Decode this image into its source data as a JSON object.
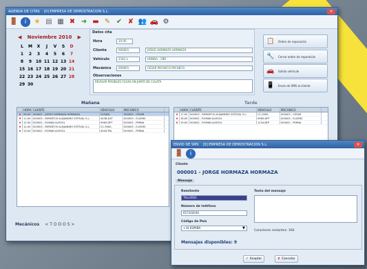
{
  "main_window": {
    "title": "AGENDA DE CITAS",
    "company": "[0] EMPRESA DE DEMOSTRACION S.L.",
    "close_label": "×"
  },
  "calendar": {
    "month_title": "Noviembre 2010",
    "weekdays": [
      "L",
      "M",
      "X",
      "J",
      "V",
      "S",
      "D"
    ],
    "days": [
      [
        "1",
        "2",
        "3",
        "4",
        "5",
        "6",
        "7"
      ],
      [
        "8",
        "9",
        "10",
        "11",
        "12",
        "13",
        "14"
      ],
      [
        "15",
        "16",
        "17",
        "18",
        "19",
        "20",
        "21"
      ],
      [
        "22",
        "23",
        "24",
        "25",
        "26",
        "27",
        "28"
      ],
      [
        "29",
        "30",
        "",
        "",
        "",
        "",
        ""
      ]
    ]
  },
  "datos_cita": {
    "title": "Datos cita",
    "hora_label": "Hora",
    "hora_value": "10:00",
    "cliente_label": "Cliente",
    "cliente_code": "000001",
    "cliente_name": "JORGE HORMAZA HORMAZA",
    "vehiculo_label": "Vehículo",
    "vehiculo_code": "2342-L",
    "vehiculo_name": "HONDA - CBR",
    "mecanico_label": "Mecánico",
    "mecanico_code": "000001",
    "mecanico_name": "CESAR PACHECO PACHECO",
    "observaciones_label": "Observaciones",
    "observaciones_value": "REVISAR POSIBLES FUGAS EN JUNTA DE CULATA"
  },
  "actions": [
    {
      "label": "Orden de reparación",
      "icon": "repair-icon"
    },
    {
      "label": "Cerrar orden de reparación",
      "icon": "wrench-icon"
    },
    {
      "label": "Salida vehículo",
      "icon": "car-icon"
    },
    {
      "label": "Envío de SMS al cliente",
      "icon": "sms-icon"
    }
  ],
  "manana": {
    "title": "Mañana",
    "headers": [
      "HORA",
      "CLIENTE",
      "VEHICULO",
      "MECANICO"
    ],
    "rows": [
      [
        "09:00",
        "000001 - JORGE HORMAZA HORMAZA",
        "2334DL",
        "000003 - CESAR"
      ],
      [
        "11:00",
        "000003 - REPARTOS ALEJANDRO ESTEVAL S.L.",
        "4438-DXT",
        "000003 - ELGERS"
      ],
      [
        "12:30",
        "000002 - ROMAN ALROOL",
        "9969-DPT",
        "000002 - PERNA"
      ],
      [
        "12:45",
        "000003 - REPARTOS ALEJANDRO ESTEVAL S.L.",
        "CC-9000-",
        "000003 - ELGERS"
      ],
      [
        "13:00",
        "000002 - ROMAN ALROOL",
        "4444-TBL",
        "000002 - PERNA"
      ]
    ]
  },
  "tarde": {
    "title": "Tarde",
    "headers": [
      "HORA",
      "CLIENTE",
      "VEHICULO",
      "MECANICO"
    ],
    "rows": [
      [
        "17:00",
        "000003 - REPARTOS ALEJANDRO ESTEVAL S.L.",
        "CC-0000-",
        "000003 - CESAR"
      ],
      [
        "18:00",
        "000002 - ROMAN ALROOL",
        "9969-DPT",
        "000003 - ELGERS"
      ],
      [
        "19:00",
        "000002 - ROMAN ALROOL",
        "1234-BFP",
        "000002 - PERNA"
      ]
    ]
  },
  "mecanicos": {
    "label": "Mecánicos",
    "value": "< T O D O S >"
  },
  "sms_dialog": {
    "title": "ENVIO DE SMS",
    "company": "[0] EMPRESA DE DEMOSTRACION S.L.",
    "cliente_label": "Cliente",
    "cliente_value": "000001 - JORGE HORMAZA HORMAZA",
    "mensaje_label": "Mensaje",
    "remitente_label": "Remitente",
    "remitente_value": "TALLERES",
    "telefono_label": "Número de teléfono",
    "telefono_value": "657102030",
    "pais_label": "Código de País",
    "pais_value": "+34 ESPAÑA",
    "texto_label": "Texto del mensaje",
    "caracteres_label": "Caracteres restantes: 160",
    "disponibles_label": "Mensajes disponibles: 9",
    "aceptar": "Aceptar",
    "cancelar": "Cancelar"
  }
}
